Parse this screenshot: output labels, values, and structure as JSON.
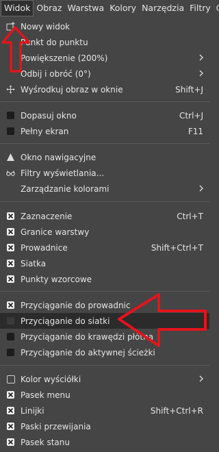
{
  "menubar": {
    "items": [
      "Widok",
      "Obraz",
      "Warstwa",
      "Kolory",
      "Narzędzia",
      "Filtry",
      "O"
    ]
  },
  "menu": {
    "items": [
      {
        "label": "Nowy widok",
        "shortcut": "",
        "icon": "new-view-icon"
      },
      {
        "label": "Punkt do punktu",
        "shortcut": "",
        "icon": "none"
      },
      {
        "label": "Powiększenie (200%)",
        "shortcut": "",
        "icon": "none",
        "submenu": true
      },
      {
        "label": "Odbij i obróć (0°)",
        "shortcut": "",
        "icon": "none",
        "submenu": true
      },
      {
        "label": "Wyśrodkuj obraz w oknie",
        "shortcut": "Shift+J",
        "icon": "move-icon"
      },
      {
        "label": "Dopasuj okno",
        "shortcut": "Ctrl+J",
        "icon": "unchecked-checkbox"
      },
      {
        "label": "Pełny ekran",
        "shortcut": "F11",
        "icon": "unchecked-checkbox"
      },
      {
        "label": "Okno nawigacyjne",
        "shortcut": "",
        "icon": "navigation-icon"
      },
      {
        "label": "Filtry wyświetlania...",
        "shortcut": "",
        "icon": "glasses-icon"
      },
      {
        "label": "Zarządzanie kolorami",
        "shortcut": "",
        "icon": "none",
        "submenu": true
      },
      {
        "label": "Zaznaczenie",
        "shortcut": "Ctrl+T",
        "icon": "checked-checkbox"
      },
      {
        "label": "Granice warstwy",
        "shortcut": "",
        "icon": "checked-checkbox"
      },
      {
        "label": "Prowadnice",
        "shortcut": "Shift+Ctrl+T",
        "icon": "checked-checkbox"
      },
      {
        "label": "Siatka",
        "shortcut": "",
        "icon": "checked-checkbox"
      },
      {
        "label": "Punkty wzorcowe",
        "shortcut": "",
        "icon": "checked-checkbox"
      },
      {
        "label": "Przyciąganie do prowadnic",
        "shortcut": "",
        "icon": "checked-checkbox"
      },
      {
        "label": "Przyciąganie do siatki",
        "shortcut": "",
        "icon": "unchecked-checkbox"
      },
      {
        "label": "Przyciąganie do krawędzi płótna",
        "shortcut": "",
        "icon": "unchecked-checkbox"
      },
      {
        "label": "Przyciąganie do aktywnej ścieżki",
        "shortcut": "",
        "icon": "unchecked-checkbox"
      },
      {
        "label": "Kolor wyściółki",
        "shortcut": "",
        "icon": "empty-checkbox",
        "submenu": true
      },
      {
        "label": "Pasek menu",
        "shortcut": "",
        "icon": "checked-checkbox"
      },
      {
        "label": "Linijki",
        "shortcut": "Shift+Ctrl+R",
        "icon": "checked-checkbox"
      },
      {
        "label": "Paski przewijania",
        "shortcut": "",
        "icon": "checked-checkbox"
      },
      {
        "label": "Pasek stanu",
        "shortcut": "",
        "icon": "checked-checkbox"
      }
    ]
  },
  "annotation": {
    "color": "#e3141c"
  }
}
